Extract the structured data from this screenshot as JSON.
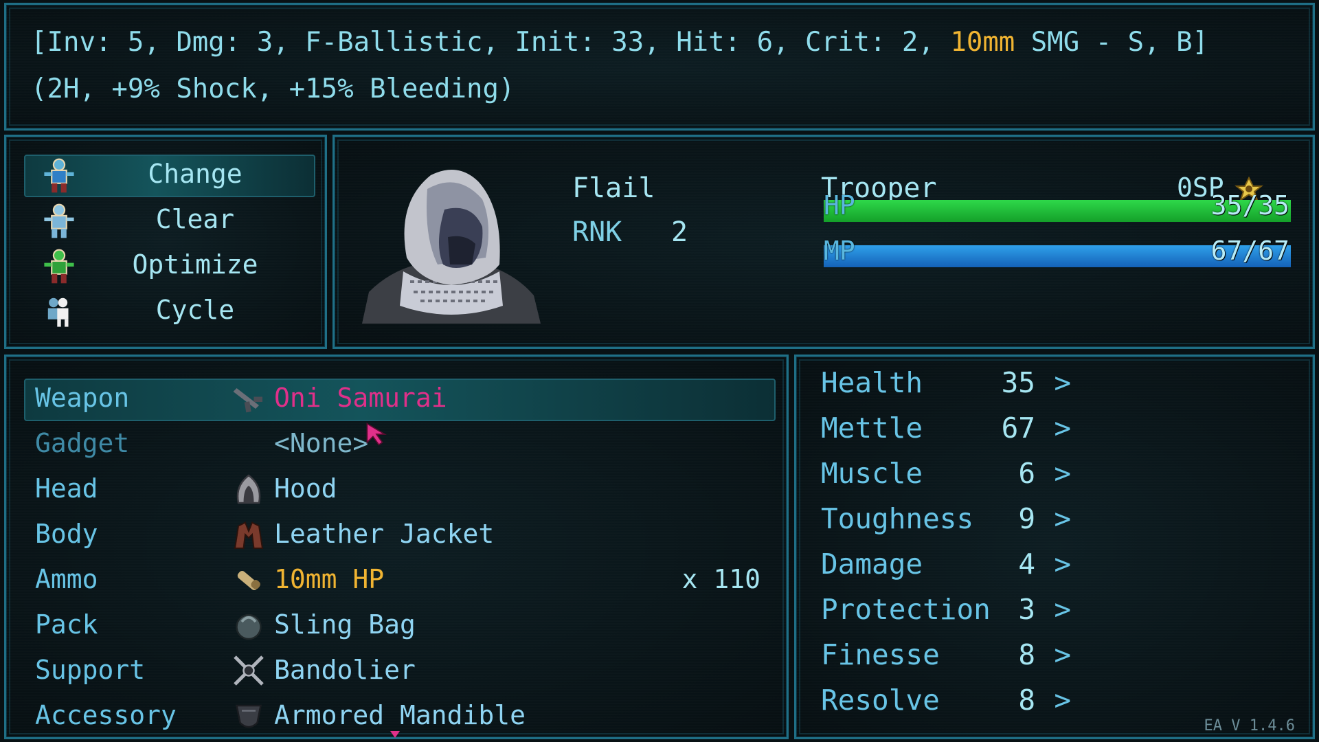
{
  "top": {
    "line1_before": "[Inv: 5, Dmg: 3, F-Ballistic, Init: 33, Hit: 6, Crit: 2, ",
    "line1_highlight": "10mm",
    "line1_after": " SMG - S, B]",
    "line2": "(2H, +9% Shock, +15% Bleeding)"
  },
  "commands": [
    {
      "label": "Change",
      "icon": "change-figure-icon",
      "selected": true
    },
    {
      "label": "Clear",
      "icon": "clear-figure-icon",
      "selected": false
    },
    {
      "label": "Optimize",
      "icon": "optimize-figure-icon",
      "selected": false
    },
    {
      "label": "Cycle",
      "icon": "cycle-figures-icon",
      "selected": false
    }
  ],
  "character": {
    "name": "Flail",
    "rank_label": "RNK",
    "rank": "2",
    "class": "Trooper",
    "sp": "0SP",
    "hp_label": "HP",
    "hp": "35/35",
    "hp_fraction": 1.0,
    "mp_label": "MP",
    "mp": "67/67",
    "mp_fraction": 1.0,
    "colors": {
      "hp": "#1fc13a",
      "mp": "#1f86d6"
    }
  },
  "equipment": [
    {
      "slot": "Weapon",
      "item": "Oni Samurai",
      "icon": "smg-icon",
      "selected": true
    },
    {
      "slot": "Gadget",
      "item": "<None>",
      "icon": "",
      "dim": true
    },
    {
      "slot": "Head",
      "item": "Hood",
      "icon": "hood-icon"
    },
    {
      "slot": "Body",
      "item": "Leather Jacket",
      "icon": "jacket-icon"
    },
    {
      "slot": "Ammo",
      "item": "10mm HP",
      "icon": "ammo-icon",
      "qty": "x 110"
    },
    {
      "slot": "Pack",
      "item": "Sling Bag",
      "icon": "bag-icon"
    },
    {
      "slot": "Support",
      "item": "Bandolier",
      "icon": "bandolier-icon"
    },
    {
      "slot": "Accessory",
      "item": "Armored Mandible",
      "icon": "mandible-icon"
    }
  ],
  "stats": [
    {
      "label": "Health",
      "value": "35",
      "arrow": ">"
    },
    {
      "label": "Mettle",
      "value": "67",
      "arrow": ">"
    },
    {
      "label": "Muscle",
      "value": "6",
      "arrow": ">"
    },
    {
      "label": "Toughness",
      "value": "9",
      "arrow": ">"
    },
    {
      "label": "Damage",
      "value": "4",
      "arrow": ">"
    },
    {
      "label": "Protection",
      "value": "3",
      "arrow": ">"
    },
    {
      "label": "Finesse",
      "value": "8",
      "arrow": ">"
    },
    {
      "label": "Resolve",
      "value": "8",
      "arrow": ">"
    }
  ],
  "version": "EA V 1.4.6"
}
